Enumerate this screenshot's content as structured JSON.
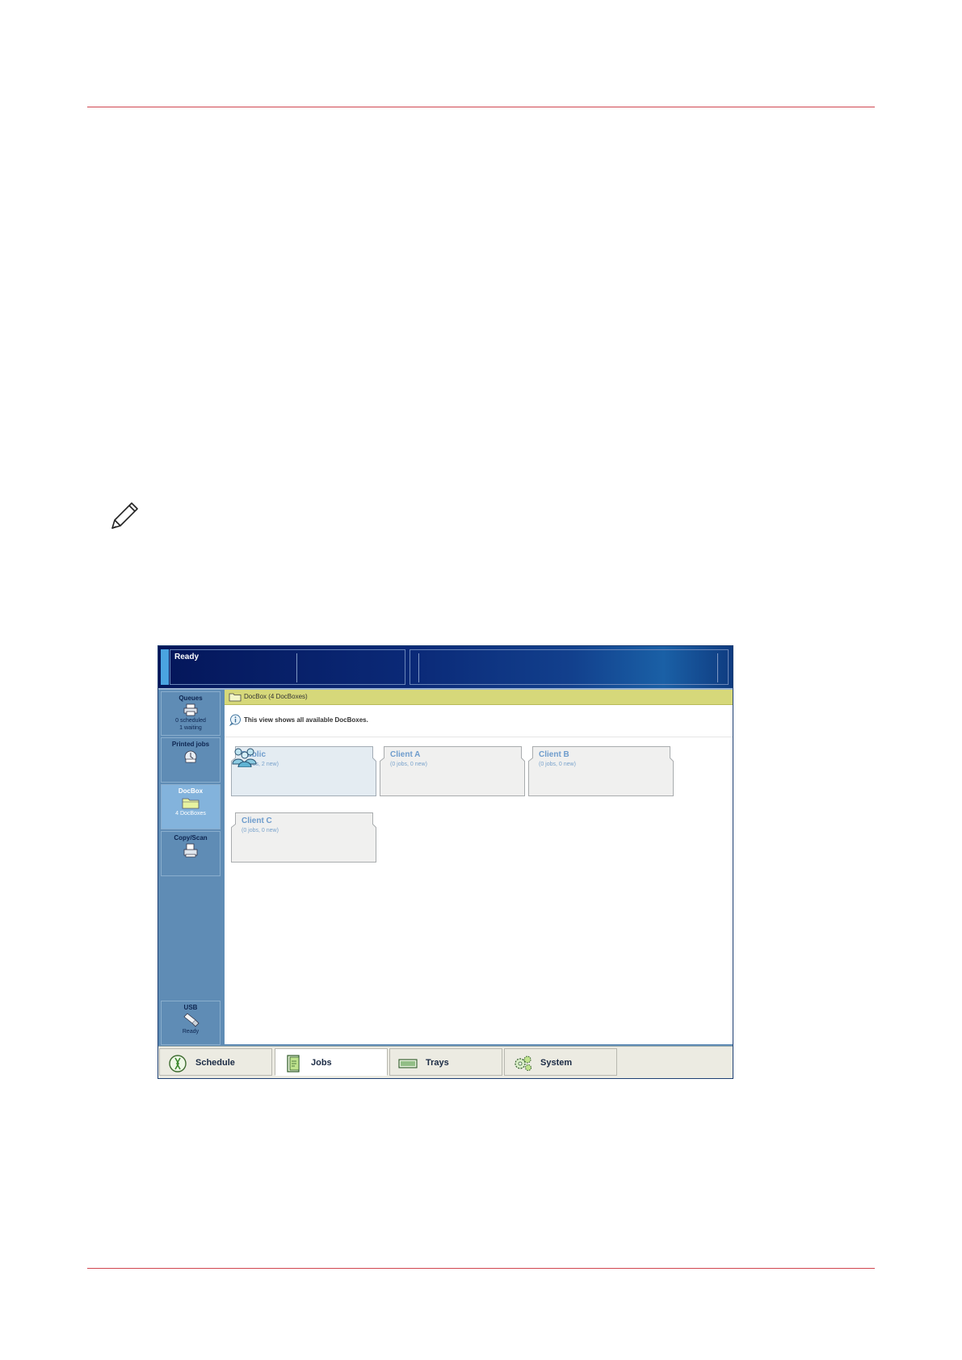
{
  "status": {
    "text": "Ready"
  },
  "sidebar": {
    "items": [
      {
        "title": "Queues",
        "sub1": "0 scheduled",
        "sub2": "1 waiting"
      },
      {
        "title": "Printed jobs"
      },
      {
        "title": "DocBox",
        "sub1": "4 DocBoxes"
      },
      {
        "title": "Copy/Scan"
      },
      {
        "title": "USB",
        "sub1": "Ready"
      }
    ]
  },
  "main": {
    "title": "DocBox (4 DocBoxes)",
    "info": "This view shows all available DocBoxes.",
    "docboxes": [
      {
        "name": "Public",
        "count": "(2 jobs, 2 new)"
      },
      {
        "name": "Client A",
        "count": "(0 jobs, 0 new)"
      },
      {
        "name": "Client B",
        "count": "(0 jobs, 0 new)"
      },
      {
        "name": "Client C",
        "count": "(0 jobs, 0 new)"
      }
    ]
  },
  "tabs": [
    {
      "label": "Schedule"
    },
    {
      "label": "Jobs"
    },
    {
      "label": "Trays"
    },
    {
      "label": "System"
    }
  ],
  "colors": {
    "accent_rule": "#d0454f",
    "sidebar": "#5f8cb5",
    "title_bar": "#d6d87a"
  }
}
